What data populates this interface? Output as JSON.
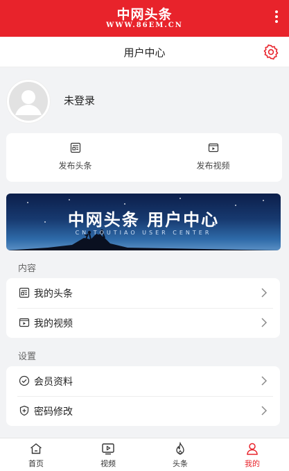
{
  "colors": {
    "brand_red": "#e8232b",
    "background": "#f2f3f5"
  },
  "app_header": {
    "logo_title": "中网头条",
    "logo_subtitle": "WWW.86EM.CN",
    "menu_icon": "more-vertical-icon"
  },
  "title_bar": {
    "title": "用户中心",
    "settings_icon": "gear-icon"
  },
  "profile": {
    "avatar_icon": "default-avatar-icon",
    "login_status": "未登录"
  },
  "publish_actions": [
    {
      "label": "发布头条",
      "icon": "article-icon"
    },
    {
      "label": "发布视频",
      "icon": "video-icon"
    }
  ],
  "banner": {
    "title": "中网头条 用户中心",
    "subtitle": "CN  TOUTIAO USER CENTER"
  },
  "content_section": {
    "label": "内容",
    "items": [
      {
        "label": "我的头条",
        "icon": "article-icon"
      },
      {
        "label": "我的视频",
        "icon": "video-icon"
      }
    ]
  },
  "settings_section": {
    "label": "设置",
    "items": [
      {
        "label": "会员资料",
        "icon": "check-circle-icon"
      },
      {
        "label": "密码修改",
        "icon": "shield-plus-icon"
      }
    ]
  },
  "tab_bar": {
    "active": "我的",
    "tabs": [
      {
        "label": "首页",
        "icon": "home-icon"
      },
      {
        "label": "视频",
        "icon": "play-icon"
      },
      {
        "label": "头条",
        "icon": "flame-icon"
      },
      {
        "label": "我的",
        "icon": "user-icon"
      }
    ]
  }
}
